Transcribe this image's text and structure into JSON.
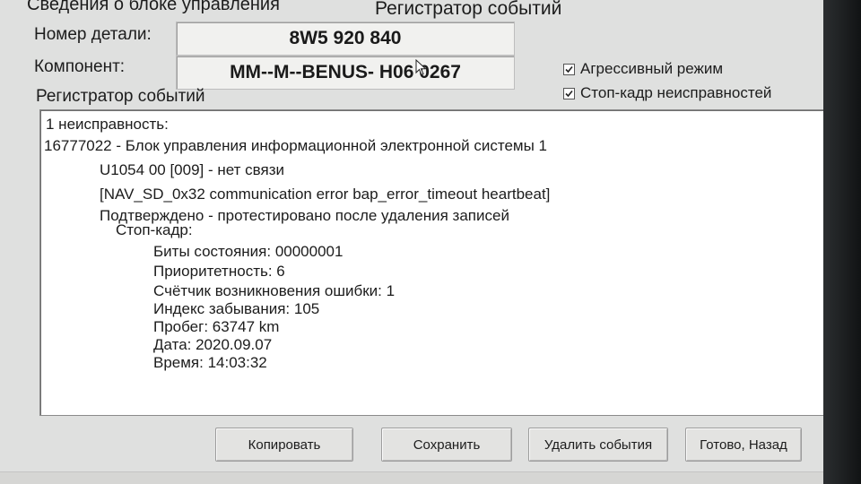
{
  "window": {
    "title": "Регистратор событий",
    "group_title": "Сведения о блоке управления"
  },
  "control_unit": {
    "part_number_label": "Номер детали:",
    "part_number_value": "8W5 920 840",
    "component_label": "Компонент:",
    "component_value": "MM--M--BENUS- H06 0267"
  },
  "options": [
    {
      "label": "Агрессивный режим",
      "checked": true
    },
    {
      "label": "Стоп-кадр неисправностей",
      "checked": true
    }
  ],
  "event_log": {
    "label": "Регистратор событий",
    "lines": [
      "1 неисправность:",
      "16777022 - Блок управления информационной электронной системы 1",
      "U1054 00 [009] - нет связи",
      "[NAV_SD_0x32 communication error bap_error_timeout heartbeat]",
      "Подтверждено - протестировано после удаления записей",
      "Стоп-кадр:",
      "Биты состояния: 00000001",
      "Приоритетность: 6",
      "Счётчик возникновения ошибки: 1",
      "Индекс забывания: 105",
      "Пробег: 63747 km",
      "Дата: 2020.09.07",
      "Время: 14:03:32"
    ]
  },
  "buttons": {
    "copy": "Копировать",
    "save": "Сохранить",
    "delete_events": "Удалить события",
    "done_back": "Готово, Назад"
  }
}
